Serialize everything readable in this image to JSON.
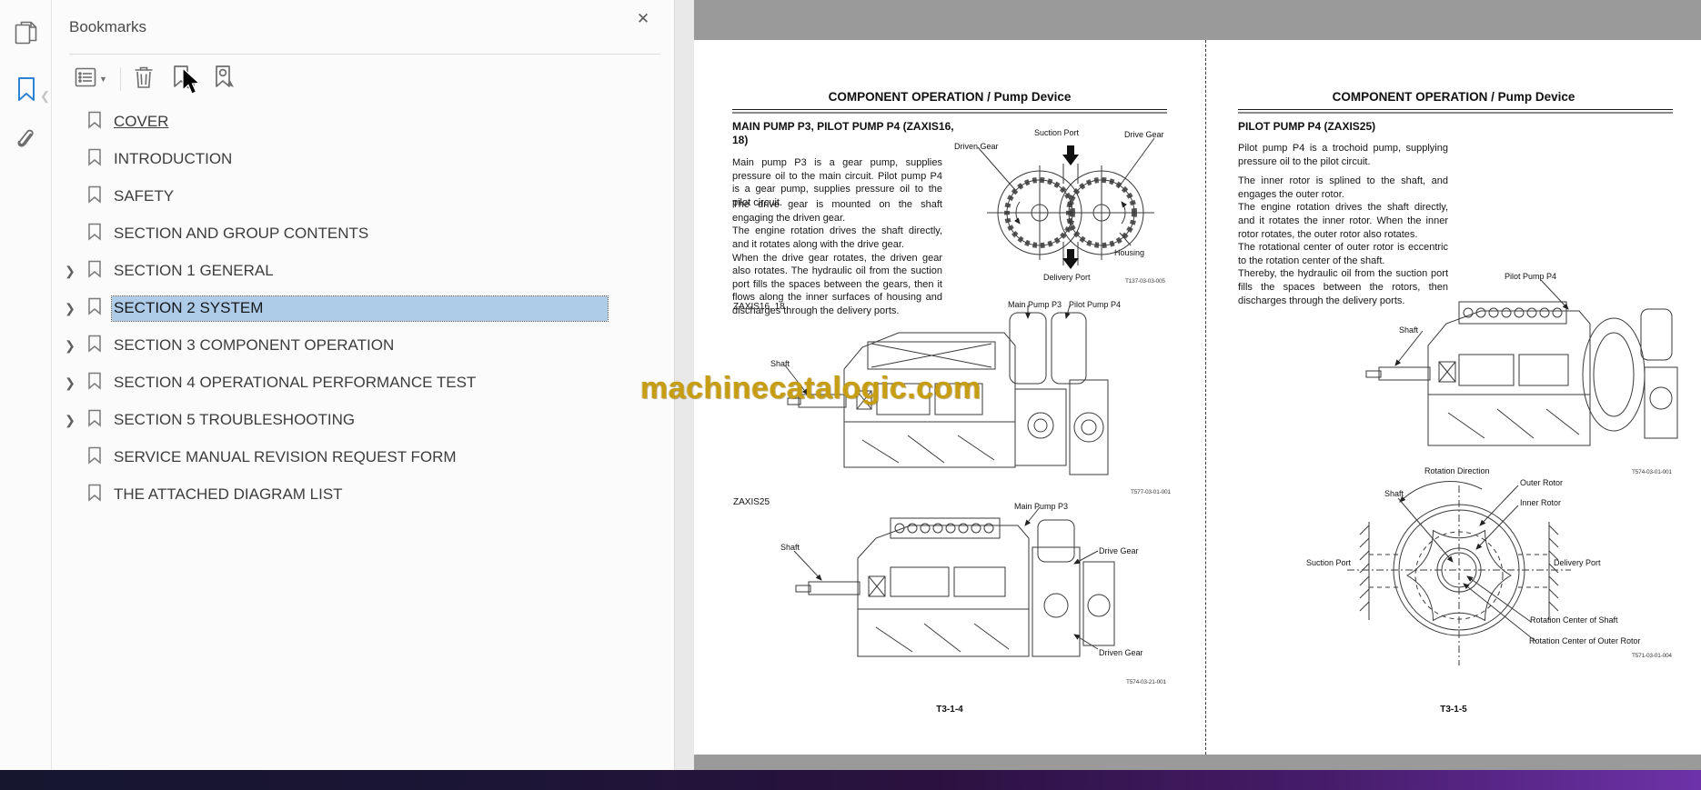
{
  "sidebar": {
    "tools": [
      {
        "name": "page-thumbnails",
        "active": false
      },
      {
        "name": "bookmarks",
        "active": true
      },
      {
        "name": "attachments",
        "active": false
      }
    ]
  },
  "bookmarks_panel": {
    "title": "Bookmarks",
    "toolbar": {
      "options": "options-menu",
      "delete": "delete-bookmark",
      "new_bookmark": "new-bookmark",
      "expand": "expand-current-bookmark"
    },
    "items": [
      {
        "label": "COVER",
        "expandable": false,
        "selected": false
      },
      {
        "label": "INTRODUCTION",
        "expandable": false,
        "selected": false
      },
      {
        "label": "SAFETY",
        "expandable": false,
        "selected": false
      },
      {
        "label": "SECTION AND GROUP CONTENTS",
        "expandable": false,
        "selected": false
      },
      {
        "label": "SECTION 1 GENERAL",
        "expandable": true,
        "selected": false
      },
      {
        "label": "SECTION 2 SYSTEM",
        "expandable": true,
        "selected": true
      },
      {
        "label": "SECTION 3 COMPONENT OPERATION",
        "expandable": true,
        "selected": false
      },
      {
        "label": "SECTION 4 OPERATIONAL PERFORMANCE TEST",
        "expandable": true,
        "selected": false
      },
      {
        "label": "SECTION 5 TROUBLESHOOTING",
        "expandable": true,
        "selected": false
      },
      {
        "label": "SERVICE MANUAL REVISION REQUEST FORM",
        "expandable": false,
        "selected": false
      },
      {
        "label": "THE ATTACHED DIAGRAM LIST",
        "expandable": false,
        "selected": false
      }
    ]
  },
  "watermark": {
    "text": "machinecatalogic.com",
    "color": "#c79d12"
  },
  "left_page": {
    "header": "COMPONENT OPERATION / Pump Device",
    "heading": "MAIN PUMP P3, PILOT PUMP P4 (ZAXIS16, 18)",
    "para1": "Main pump P3 is a gear pump, supplies pressure oil to the main circuit. Pilot pump P4 is a gear pump, supplies pressure oil to the pilot circuit.",
    "para2_lines": [
      "The drive gear is mounted on the shaft engaging the driven gear.",
      "The engine rotation drives the shaft directly, and it rotates along with the drive gear.",
      "When the drive gear rotates, the driven gear also rotates. The hydraulic oil from the suction port fills the spaces between the gears, then it flows along the inner surfaces of housing and discharges through the delivery ports."
    ],
    "figure_gear": {
      "driven_gear": "Driven Gear",
      "suction_port": "Suction Port",
      "drive_gear": "Drive Gear",
      "housing": "Housing",
      "delivery_port": "Delivery Port",
      "fig_no": "T137-03-03-005"
    },
    "zaxis16_caption": "ZAXIS16, 18",
    "figure1": {
      "shaft": "Shaft",
      "main_pump": "Main Pump P3",
      "pilot_pump": "Pilot Pump P4",
      "fig_no": "T577-03-01-001"
    },
    "zaxis25_caption": "ZAXIS25",
    "figure2": {
      "shaft": "Shaft",
      "main_pump": "Main Pump P3",
      "drive_gear": "Drive Gear",
      "driven_gear": "Driven Gear",
      "fig_no": "T574-03-21-001"
    },
    "page_number": "T3-1-4"
  },
  "right_page": {
    "header": "COMPONENT OPERATION / Pump Device",
    "heading": "PILOT PUMP P4 (ZAXIS25)",
    "para1": "Pilot pump P4 is a trochoid pump, supplying pressure oil to the pilot circuit.",
    "para2_lines": [
      "The inner rotor is splined to the shaft, and engages the outer rotor.",
      "The engine rotation drives the shaft directly, and it rotates the inner rotor. When the inner rotor rotates, the outer rotor also rotates.",
      "The rotational center of outer rotor is eccentric to the rotation center of the shaft.",
      "Thereby, the hydraulic oil from the suction port fills the spaces between the rotors, then discharges through the delivery ports."
    ],
    "figure1": {
      "pilot_pump": "Pilot Pump P4",
      "shaft": "Shaft",
      "fig_no": "T574-03-01-001"
    },
    "figure2": {
      "rotation_direction": "Rotation Direction",
      "outer_rotor": "Outer Rotor",
      "inner_rotor": "Inner Rotor",
      "shaft": "Shaft",
      "suction_port": "Suction Port",
      "delivery_port": "Delivery Port",
      "rotation_center_shaft": "Rotation Center of Shaft",
      "rotation_center_outer": "Rotation Center of Outer Rotor",
      "fig_no": "T571-03-01-004"
    },
    "page_number": "T3-1-5"
  },
  "colors": {
    "doc_background": "#9a9a9b",
    "selection": "#aecbe8",
    "active_tool_icon": "#2e82d6",
    "taskbar_gradient_start": "#15152e",
    "taskbar_gradient_end": "#6d32a8"
  }
}
